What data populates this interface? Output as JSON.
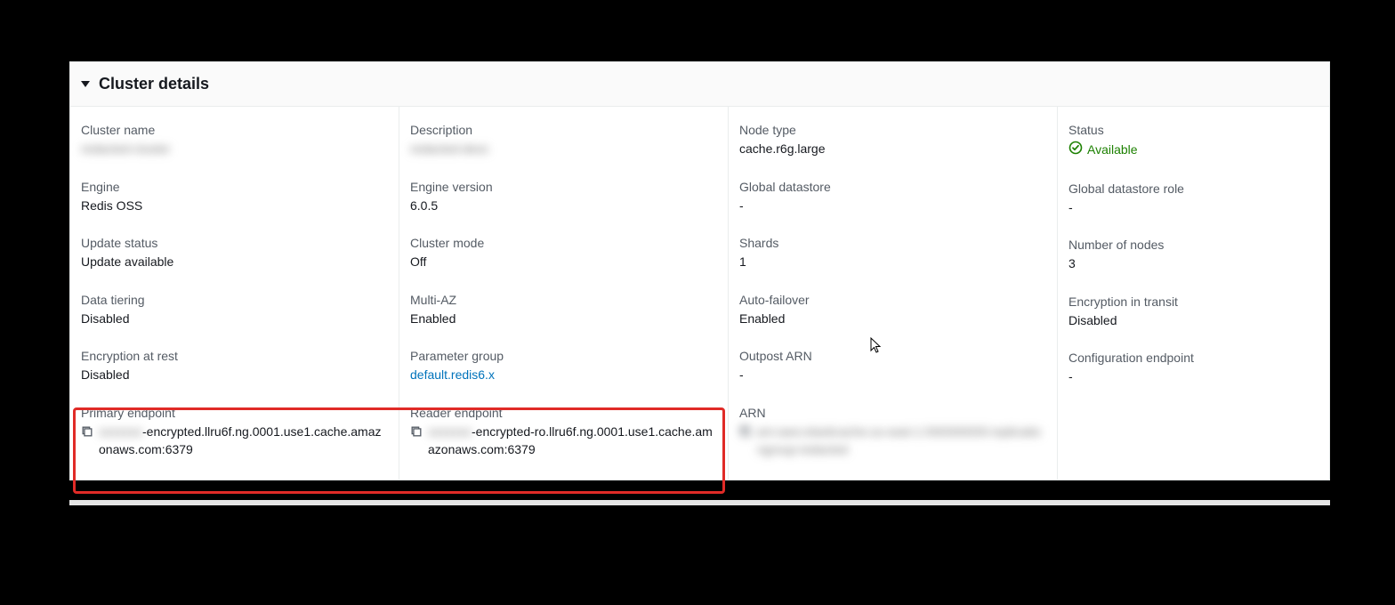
{
  "header": {
    "title": "Cluster details"
  },
  "col1": {
    "cluster_name_label": "Cluster name",
    "cluster_name_value": "redacted-cluster",
    "engine_label": "Engine",
    "engine_value": "Redis OSS",
    "update_status_label": "Update status",
    "update_status_value": "Update available",
    "data_tiering_label": "Data tiering",
    "data_tiering_value": "Disabled",
    "enc_at_rest_label": "Encryption at rest",
    "enc_at_rest_value": "Disabled",
    "primary_ep_label": "Primary endpoint",
    "primary_ep_prefix": "xxxxxxx",
    "primary_ep_suffix": "-encrypted.llru6f.ng.0001.use1.cache.amazonaws.com:6379"
  },
  "col2": {
    "description_label": "Description",
    "description_value": "redacted-desc",
    "engine_version_label": "Engine version",
    "engine_version_value": "6.0.5",
    "cluster_mode_label": "Cluster mode",
    "cluster_mode_value": "Off",
    "multi_az_label": "Multi-AZ",
    "multi_az_value": "Enabled",
    "param_group_label": "Parameter group",
    "param_group_value": "default.redis6.x",
    "reader_ep_label": "Reader endpoint",
    "reader_ep_prefix": "xxxxxxx",
    "reader_ep_suffix": "-encrypted-ro.llru6f.ng.0001.use1.cache.amazonaws.com:6379"
  },
  "col3": {
    "node_type_label": "Node type",
    "node_type_value": "cache.r6g.large",
    "global_ds_label": "Global datastore",
    "global_ds_value": "-",
    "shards_label": "Shards",
    "shards_value": "1",
    "auto_failover_label": "Auto-failover",
    "auto_failover_value": "Enabled",
    "outpost_arn_label": "Outpost ARN",
    "outpost_arn_value": "-",
    "arn_label": "ARN",
    "arn_value": "arn:aws:elasticache:us-east-1:000000000:replicationgroup:redacted"
  },
  "col4": {
    "status_label": "Status",
    "status_value": "Available",
    "global_ds_role_label": "Global datastore role",
    "global_ds_role_value": "-",
    "num_nodes_label": "Number of nodes",
    "num_nodes_value": "3",
    "enc_transit_label": "Encryption in transit",
    "enc_transit_value": "Disabled",
    "config_ep_label": "Configuration endpoint",
    "config_ep_value": "-"
  }
}
